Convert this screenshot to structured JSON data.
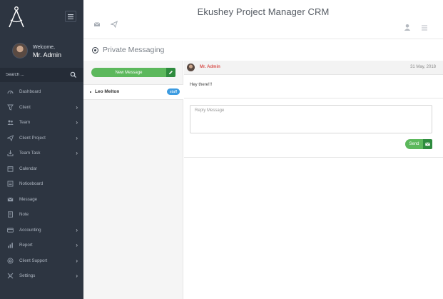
{
  "app": {
    "title": "Ekushey Project Manager CRM"
  },
  "sidebar": {
    "welcome_label": "Welcome,",
    "username": "Mr. Admin",
    "search_placeholder": "Search ...",
    "items": [
      {
        "label": "Dashboard",
        "icon": "dashboard-icon",
        "has_submenu": false
      },
      {
        "label": "Client",
        "icon": "client-icon",
        "has_submenu": true
      },
      {
        "label": "Team",
        "icon": "team-icon",
        "has_submenu": true
      },
      {
        "label": "Client Project",
        "icon": "send-icon",
        "has_submenu": true
      },
      {
        "label": "Team Task",
        "icon": "task-icon",
        "has_submenu": true
      },
      {
        "label": "Calendar",
        "icon": "calendar-icon",
        "has_submenu": false
      },
      {
        "label": "Noticeboard",
        "icon": "noticeboard-icon",
        "has_submenu": false
      },
      {
        "label": "Message",
        "icon": "message-icon",
        "has_submenu": false
      },
      {
        "label": "Note",
        "icon": "note-icon",
        "has_submenu": false
      },
      {
        "label": "Accounting",
        "icon": "accounting-icon",
        "has_submenu": true
      },
      {
        "label": "Report",
        "icon": "report-icon",
        "has_submenu": true
      },
      {
        "label": "Client Support",
        "icon": "support-icon",
        "has_submenu": true
      },
      {
        "label": "Settings",
        "icon": "settings-icon",
        "has_submenu": true
      }
    ]
  },
  "page": {
    "heading": "Private Messaging",
    "new_message_label": "New Message",
    "contacts": [
      {
        "name": "Leo Melton",
        "badge": "staff"
      }
    ],
    "message": {
      "author": "Mr. Admin",
      "date": "31 May, 2018",
      "body": "Hey there!!!"
    },
    "reply_placeholder": "Reply Message",
    "send_label": "Send"
  },
  "colors": {
    "sidebar_bg": "#2d3541",
    "accent_green": "#5cb85c",
    "accent_green_dark": "#2e8b3e",
    "author_red": "#d9534f",
    "badge_blue": "#3c9be0"
  }
}
